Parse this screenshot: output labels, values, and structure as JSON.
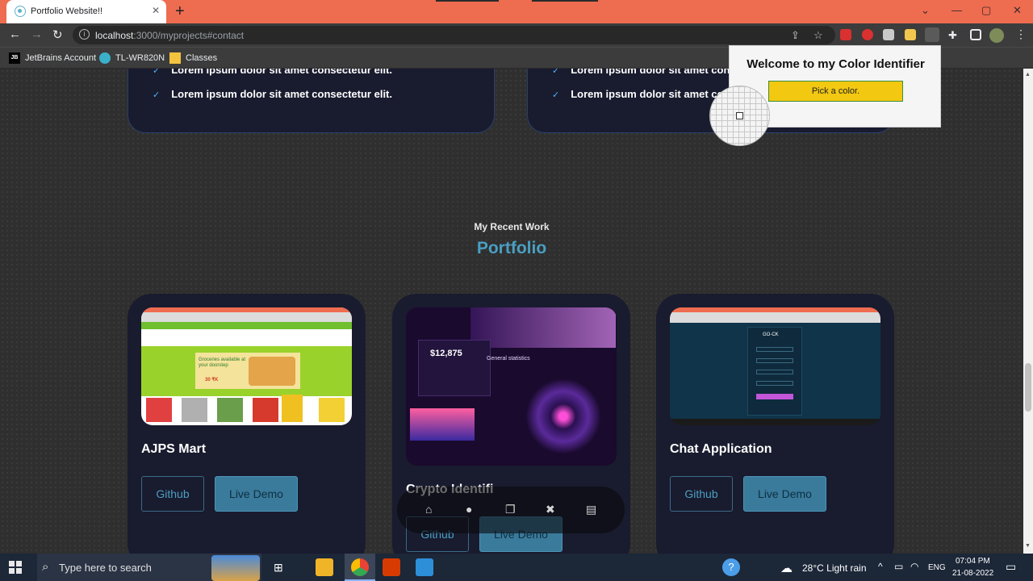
{
  "browser": {
    "tab_title": "Portfolio Website!!",
    "tab_close": "✕",
    "new_tab": "+",
    "url_host": "localhost",
    "url_rest": ":3000/myprojects#contact",
    "bookmarks": [
      "JetBrains Account",
      "TL-WR820N",
      "Classes"
    ],
    "bookmark_icon_jb": "JB"
  },
  "page": {
    "skills_left": [
      "Lorem ipsum dolor sit amet consectetur elit.",
      "Lorem ipsum dolor sit amet consectetur elit."
    ],
    "skills_right": [
      "Lorem ipsum dolor sit amet cons",
      "Lorem ipsum dolor sit amet co"
    ],
    "check": "✓",
    "section_subtitle": "My Recent Work",
    "section_title": "Portfolio",
    "projects": [
      {
        "title": "AJPS Mart",
        "github": "Github",
        "demo": "Live Demo"
      },
      {
        "title": "Crypto Identifi",
        "github": "Github",
        "demo": "Live Demo"
      },
      {
        "title": "Chat Application",
        "github": "Github",
        "demo": "Live Demo"
      }
    ],
    "mart_banner": "Groceries available at your doorstep",
    "mart_banner_price": "30 ₹K",
    "crypto_amount": "$12,875",
    "crypto_stats": "General statistics",
    "chat_logo": "GO-CK"
  },
  "popup": {
    "title": "Welcome to my Color Identifier",
    "button": "Pick a color."
  },
  "taskbar": {
    "search_placeholder": "Type here to search",
    "weather": "28°C  Light rain",
    "lang": "ENG",
    "time": "07:04 PM",
    "date": "21-08-2022"
  }
}
